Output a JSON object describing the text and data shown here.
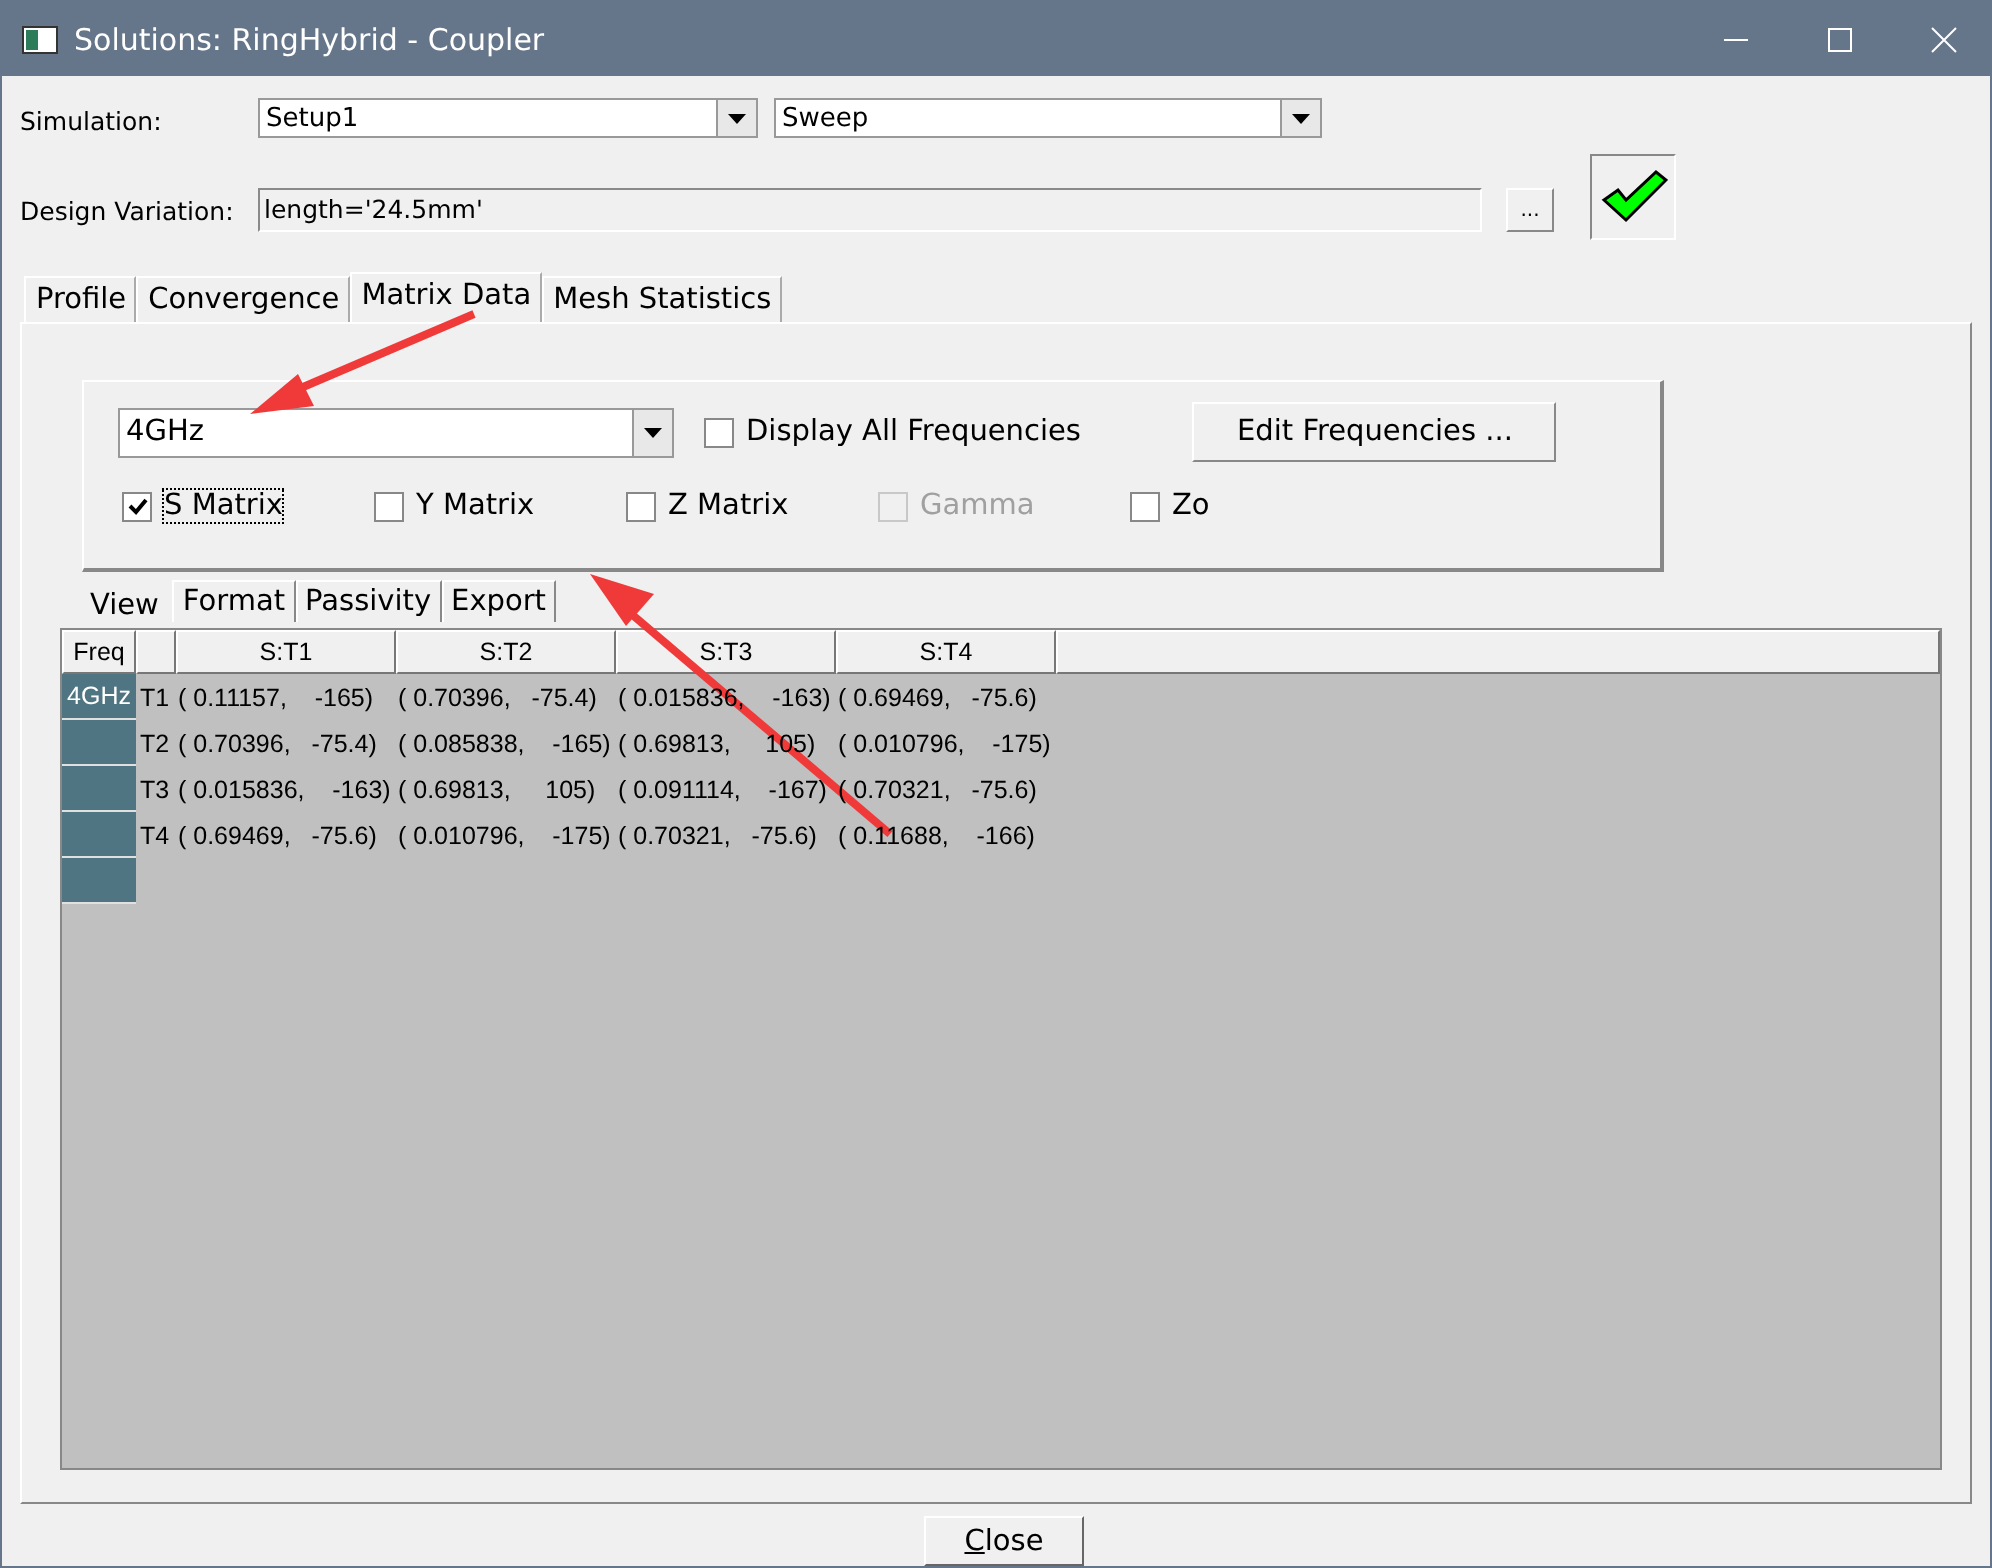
{
  "window": {
    "title": "Solutions: RingHybrid - Coupler"
  },
  "simulation": {
    "label": "Simulation:",
    "setup": "Setup1",
    "sweep": "Sweep"
  },
  "design_variation": {
    "label": "Design Variation:",
    "value": "length='24.5mm'",
    "browse_button": "...",
    "solved": true
  },
  "tabs": [
    {
      "label": "Profile",
      "selected": false
    },
    {
      "label": "Convergence",
      "selected": false
    },
    {
      "label": "Matrix Data",
      "selected": true
    },
    {
      "label": "Mesh Statistics",
      "selected": false
    }
  ],
  "frequency": {
    "value": "4GHz",
    "display_all": {
      "label": "Display All Frequencies",
      "checked": false
    },
    "edit_button": "Edit Frequencies ..."
  },
  "matrix_options": [
    {
      "label": "S Matrix",
      "checked": true,
      "disabled": false,
      "focused": true
    },
    {
      "label": "Y Matrix",
      "checked": false,
      "disabled": false,
      "focused": false
    },
    {
      "label": "Z Matrix",
      "checked": false,
      "disabled": false,
      "focused": false
    },
    {
      "label": "Gamma",
      "checked": false,
      "disabled": true,
      "focused": false
    },
    {
      "label": "Zo",
      "checked": false,
      "disabled": false,
      "focused": false
    }
  ],
  "sub_tabs": [
    {
      "label": "View",
      "selected": true
    },
    {
      "label": "Format",
      "selected": false
    },
    {
      "label": "Passivity",
      "selected": false
    },
    {
      "label": "Export",
      "selected": false
    }
  ],
  "table": {
    "freq_header": "Freq",
    "columns": [
      "S:T1",
      "S:T2",
      "S:T3",
      "S:T4"
    ],
    "rows": [
      {
        "freq": "4GHz",
        "port": "T1",
        "cells": [
          "( 0.11157,    -165)",
          "( 0.70396,   -75.4)",
          "( 0.015836,    -163)",
          "( 0.69469,   -75.6)"
        ]
      },
      {
        "port": "T2",
        "cells": [
          "( 0.70396,   -75.4)",
          "( 0.085838,    -165)",
          "( 0.69813,     105)",
          "( 0.010796,    -175)"
        ]
      },
      {
        "port": "T3",
        "cells": [
          "( 0.015836,    -163)",
          "( 0.69813,     105)",
          "( 0.091114,    -167)",
          "( 0.70321,   -75.6)"
        ]
      },
      {
        "port": "T4",
        "cells": [
          "( 0.69469,   -75.6)",
          "( 0.010796,    -175)",
          "( 0.70321,   -75.6)",
          "( 0.11688,    -166)"
        ]
      }
    ]
  },
  "close_button": "Close"
}
